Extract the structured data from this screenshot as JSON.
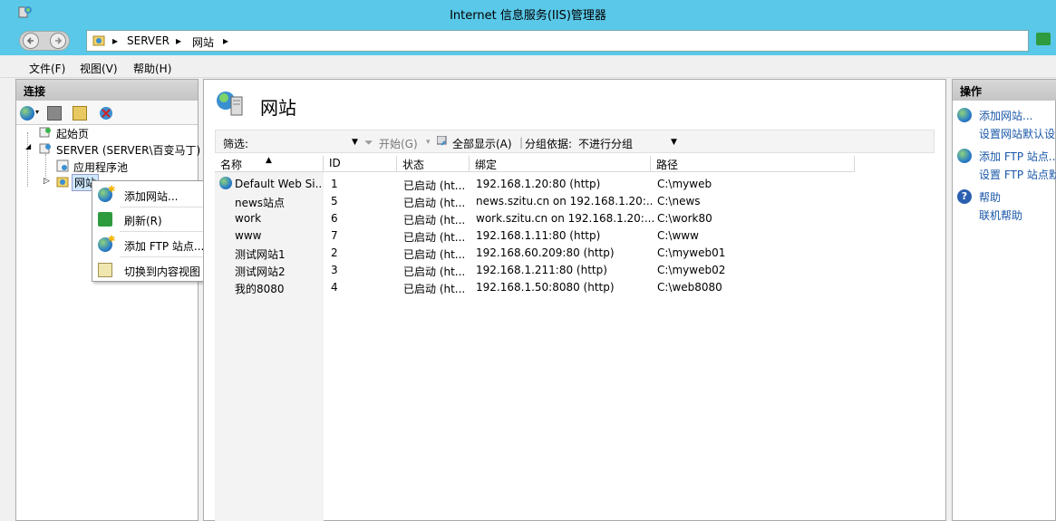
{
  "window": {
    "title": "Internet 信息服务(IIS)管理器"
  },
  "address": {
    "crumbs": [
      "SERVER",
      "网站"
    ]
  },
  "menu": {
    "items": [
      "文件(F)",
      "视图(V)",
      "帮助(H)"
    ]
  },
  "connections": {
    "header": "连接",
    "tree": {
      "start_page": "起始页",
      "server": "SERVER (SERVER\\百变马丁)",
      "app_pools": "应用程序池",
      "sites": "网站"
    }
  },
  "context_menu": {
    "items": [
      "添加网站...",
      "刷新(R)",
      "添加 FTP 站点...",
      "切换到内容视图"
    ]
  },
  "center": {
    "heading": "网站",
    "filter": {
      "label": "筛选:",
      "start": "开始(G)",
      "show_all": "全部显示(A)",
      "group_by_label": "分组依据:",
      "group_by_value": "不进行分组"
    },
    "columns": [
      "名称",
      "ID",
      "状态",
      "绑定",
      "路径"
    ],
    "rows": [
      {
        "name": "Default Web Si...",
        "id": "1",
        "status": "已启动 (ht...",
        "binding": "192.168.1.20:80 (http)",
        "path": "C:\\myweb"
      },
      {
        "name": "news站点",
        "id": "5",
        "status": "已启动 (ht...",
        "binding": "news.szitu.cn on 192.168.1.20:...",
        "path": "C:\\news"
      },
      {
        "name": "work",
        "id": "6",
        "status": "已启动 (ht...",
        "binding": "work.szitu.cn on 192.168.1.20:...",
        "path": "C:\\work80"
      },
      {
        "name": "www",
        "id": "7",
        "status": "已启动 (ht...",
        "binding": "192.168.1.11:80 (http)",
        "path": "C:\\www"
      },
      {
        "name": "测试网站1",
        "id": "2",
        "status": "已启动 (ht...",
        "binding": "192.168.60.209:80 (http)",
        "path": "C:\\myweb01"
      },
      {
        "name": "测试网站2",
        "id": "3",
        "status": "已启动 (ht...",
        "binding": "192.168.1.211:80 (http)",
        "path": "C:\\myweb02"
      },
      {
        "name": "我的8080",
        "id": "4",
        "status": "已启动 (ht...",
        "binding": "192.168.1.50:8080 (http)",
        "path": "C:\\web8080"
      }
    ]
  },
  "actions": {
    "header": "操作",
    "items": [
      "添加网站...",
      "设置网站默认设",
      "添加 FTP 站点...",
      "设置 FTP 站点默",
      "帮助",
      "联机帮助"
    ]
  },
  "colors": {
    "titlebar": "#5ac8e8",
    "link": "#1a57a8",
    "arrow": "#e02020"
  }
}
